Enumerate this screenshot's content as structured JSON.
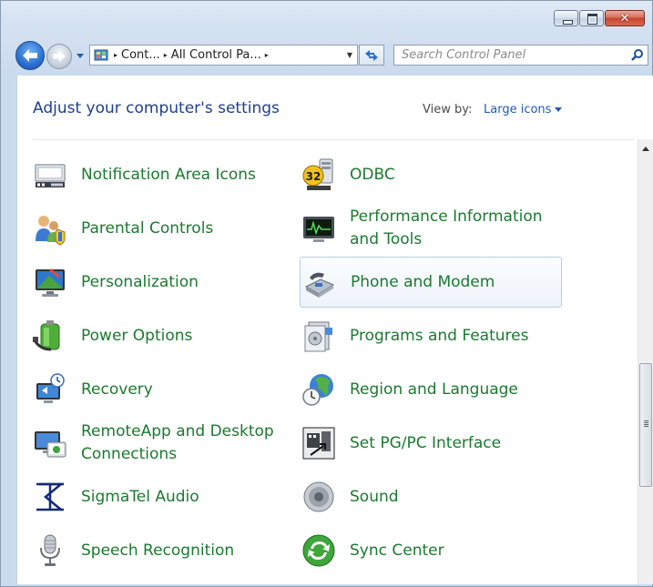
{
  "window": {
    "close_glyph": "✕"
  },
  "address": {
    "crumbs": [
      "Cont...",
      "All Control Pa..."
    ],
    "separator": "▸",
    "dropdown": "▼"
  },
  "search": {
    "placeholder": "Search Control Panel"
  },
  "header": {
    "title": "Adjust your computer's settings",
    "view_by_label": "View by:",
    "view_by_value": "Large icons"
  },
  "items_left": [
    {
      "label": "Notification Area Icons",
      "icon": "notification-area-icon"
    },
    {
      "label": "Parental Controls",
      "icon": "parental-controls-icon"
    },
    {
      "label": "Personalization",
      "icon": "personalization-icon"
    },
    {
      "label": "Power Options",
      "icon": "power-options-icon"
    },
    {
      "label": "Recovery",
      "icon": "recovery-icon"
    },
    {
      "label": "RemoteApp and Desktop Connections",
      "icon": "remoteapp-icon"
    },
    {
      "label": "SigmaTel Audio",
      "icon": "sigmatel-audio-icon"
    },
    {
      "label": "Speech Recognition",
      "icon": "microphone-icon"
    }
  ],
  "items_right": [
    {
      "label": "ODBC",
      "icon": "odbc-icon",
      "badge": "32"
    },
    {
      "label": "Performance Information and Tools",
      "icon": "performance-monitor-icon"
    },
    {
      "label": "Phone and Modem",
      "icon": "phone-modem-icon"
    },
    {
      "label": "Programs and Features",
      "icon": "programs-features-icon"
    },
    {
      "label": "Region and Language",
      "icon": "globe-clock-icon"
    },
    {
      "label": "Set PG/PC Interface",
      "icon": "pg-pc-interface-icon"
    },
    {
      "label": "Sound",
      "icon": "speaker-icon"
    },
    {
      "label": "Sync Center",
      "icon": "sync-center-icon"
    }
  ],
  "colors": {
    "link_green": "#1a7a2e",
    "heading_blue": "#1e3f8c",
    "accent_blue": "#1e5bb8"
  }
}
